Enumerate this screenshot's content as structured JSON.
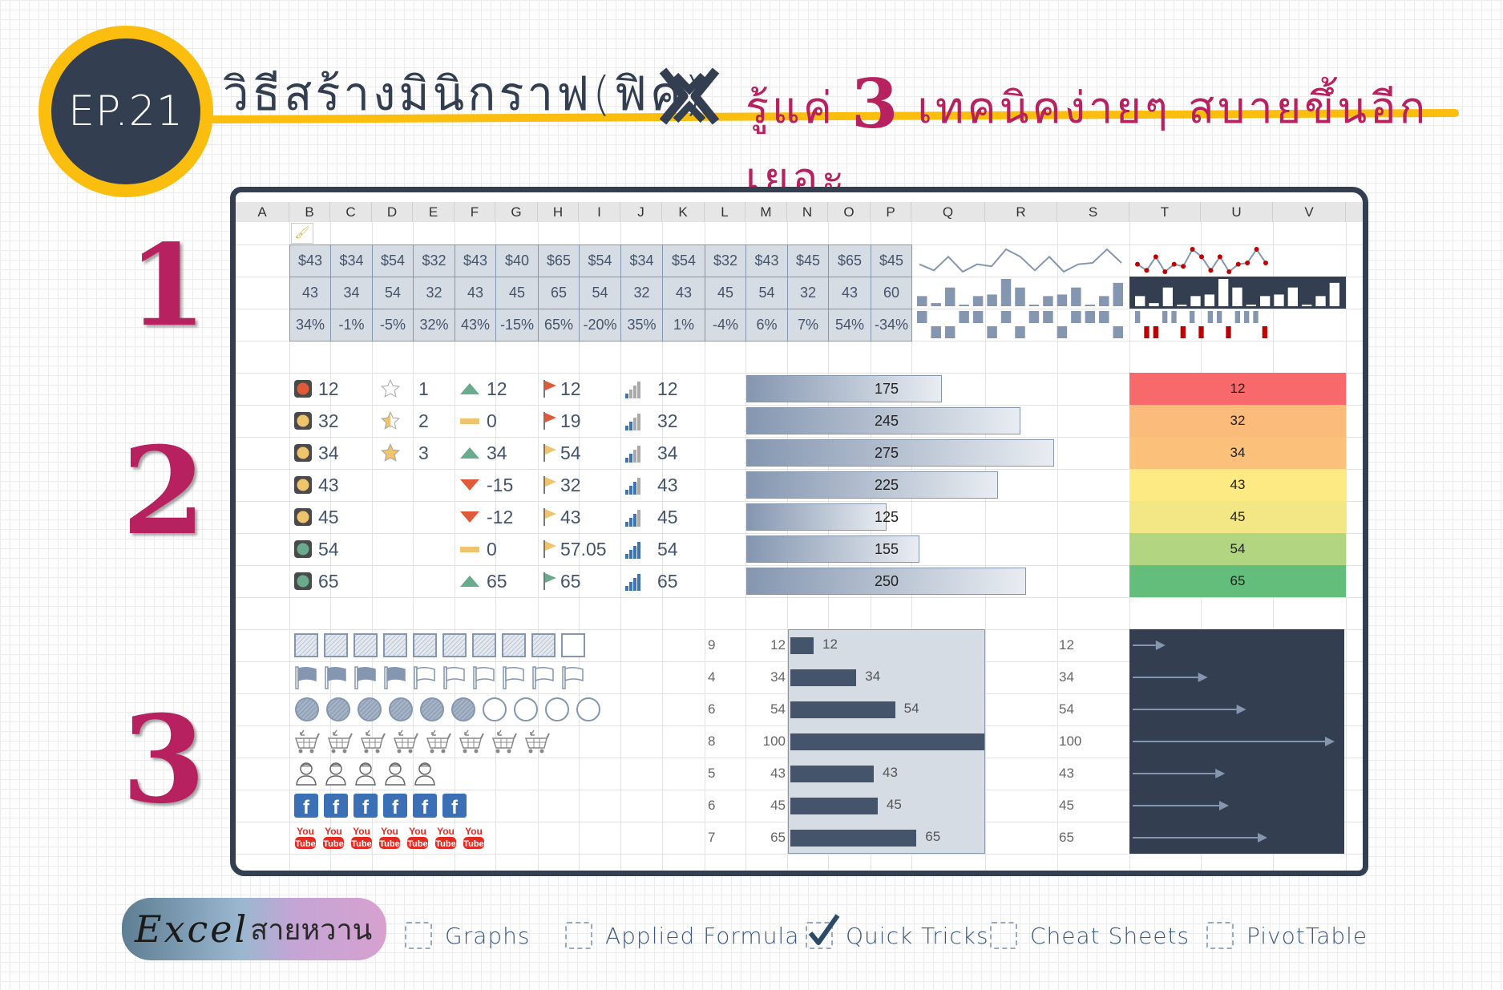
{
  "header": {
    "episode": "EP.21",
    "title_left": "วิธีสร้างมินิกราฟ(ฟิค)",
    "title_right_prefix": "รู้แค่",
    "title_number": "3",
    "title_right_suffix": "เทคนิคง่ายๆ สบายขึ้นอีกเยอะ",
    "accent_color": "#fbbd0e",
    "brand_color": "#b8215f",
    "dark_color": "#333f50"
  },
  "section_numbers": [
    "1",
    "2",
    "3"
  ],
  "sheet": {
    "columns": [
      "A",
      "B",
      "C",
      "D",
      "E",
      "F",
      "G",
      "H",
      "I",
      "J",
      "K",
      "L",
      "M",
      "N",
      "O",
      "P",
      "Q",
      "R",
      "S",
      "T",
      "U",
      "V"
    ],
    "section1": {
      "row_prices": [
        "$43",
        "$34",
        "$54",
        "$32",
        "$43",
        "$40",
        "$65",
        "$54",
        "$34",
        "$54",
        "$32",
        "$43",
        "$45",
        "$65",
        "$45"
      ],
      "row_values": [
        "43",
        "34",
        "54",
        "32",
        "43",
        "45",
        "65",
        "54",
        "32",
        "43",
        "45",
        "54",
        "32",
        "43",
        "60"
      ],
      "row_percents": [
        "34%",
        "-1%",
        "-5%",
        "32%",
        "43%",
        "-15%",
        "65%",
        "-20%",
        "35%",
        "1%",
        "-4%",
        "6%",
        "7%",
        "54%",
        "-34%"
      ],
      "sparkline_line_values": [
        43,
        34,
        54,
        32,
        43,
        40,
        65,
        54,
        34,
        54,
        32,
        43,
        45,
        65,
        45
      ],
      "sparkline_column_values": [
        43,
        34,
        54,
        32,
        43,
        45,
        65,
        54,
        32,
        43,
        45,
        54,
        32,
        43,
        60
      ],
      "sparkline_winloss_values": [
        34,
        -1,
        -5,
        32,
        43,
        -15,
        65,
        -20,
        35,
        1,
        -4,
        6,
        7,
        54,
        -34
      ],
      "marker_color": "#c00000",
      "series_color": "#8496b0"
    },
    "section2": {
      "traffic_lights": [
        {
          "value": "12",
          "color": "#e05a3a"
        },
        {
          "value": "32",
          "color": "#f0c36d"
        },
        {
          "value": "34",
          "color": "#f0c36d"
        },
        {
          "value": "43",
          "color": "#f0c36d"
        },
        {
          "value": "45",
          "color": "#f0c36d"
        },
        {
          "value": "54",
          "color": "#6aab8e"
        },
        {
          "value": "65",
          "color": "#6aab8e"
        }
      ],
      "stars": [
        {
          "value": "1",
          "fill": "empty"
        },
        {
          "value": "2",
          "fill": "half"
        },
        {
          "value": "3",
          "fill": "full"
        }
      ],
      "trends": [
        {
          "value": "12",
          "dir": "up"
        },
        {
          "value": "0",
          "dir": "flat"
        },
        {
          "value": "34",
          "dir": "up"
        },
        {
          "value": "-15",
          "dir": "down"
        },
        {
          "value": "-12",
          "dir": "down"
        },
        {
          "value": "0",
          "dir": "flat"
        },
        {
          "value": "65",
          "dir": "up"
        }
      ],
      "flags": [
        {
          "value": "12",
          "color": "#e05a3a"
        },
        {
          "value": "19",
          "color": "#e05a3a"
        },
        {
          "value": "54",
          "color": "#f0c36d"
        },
        {
          "value": "32",
          "color": "#f0c36d"
        },
        {
          "value": "43",
          "color": "#f0c36d"
        },
        {
          "value": "57.05",
          "color": "#f0c36d"
        },
        {
          "value": "65",
          "color": "#6aab8e"
        }
      ],
      "signal_bars": [
        {
          "value": "12",
          "level": 1
        },
        {
          "value": "32",
          "level": 2
        },
        {
          "value": "34",
          "level": 2
        },
        {
          "value": "43",
          "level": 3
        },
        {
          "value": "45",
          "level": 3
        },
        {
          "value": "54",
          "level": 4
        },
        {
          "value": "65",
          "level": 4
        }
      ],
      "data_bars": {
        "values": [
          175,
          245,
          275,
          225,
          125,
          155,
          250
        ],
        "max": 275
      },
      "color_scale": [
        {
          "value": "12",
          "color": "#f8696b"
        },
        {
          "value": "32",
          "color": "#fbbb7a"
        },
        {
          "value": "34",
          "color": "#fbc17b"
        },
        {
          "value": "43",
          "color": "#feea83"
        },
        {
          "value": "45",
          "color": "#f2e685"
        },
        {
          "value": "54",
          "color": "#b1d580"
        },
        {
          "value": "65",
          "color": "#63be7b"
        }
      ]
    },
    "section3": {
      "pictographs": [
        {
          "type": "square",
          "filled": 9,
          "total": 10
        },
        {
          "type": "flag",
          "filled": 4,
          "total": 10
        },
        {
          "type": "circle",
          "filled": 6,
          "total": 10
        },
        {
          "type": "cart",
          "count": 8
        },
        {
          "type": "person",
          "count": 5
        },
        {
          "type": "facebook",
          "count": 6
        },
        {
          "type": "youtube",
          "count": 7
        }
      ],
      "counts": [
        "9",
        "4",
        "6",
        "8",
        "5",
        "6",
        "7"
      ],
      "bar_values": [
        12,
        34,
        54,
        100,
        43,
        45,
        65
      ],
      "bar_labels": [
        "12",
        "34",
        "54",
        "100",
        "43",
        "45",
        "65"
      ],
      "bar_max": 100,
      "arrow_labels": [
        "12",
        "34",
        "54",
        "100",
        "43",
        "45",
        "65"
      ],
      "arrow_values": [
        12,
        34,
        54,
        100,
        43,
        45,
        65
      ]
    }
  },
  "footer": {
    "logo_text": "Excel",
    "logo_text_thai": "สายหวาน",
    "categories": [
      {
        "label": "Graphs",
        "checked": false
      },
      {
        "label": "Applied Formula",
        "checked": false
      },
      {
        "label": "Quick Tricks",
        "checked": true
      },
      {
        "label": "Cheat Sheets",
        "checked": false
      },
      {
        "label": "PivotTable",
        "checked": false
      }
    ]
  }
}
